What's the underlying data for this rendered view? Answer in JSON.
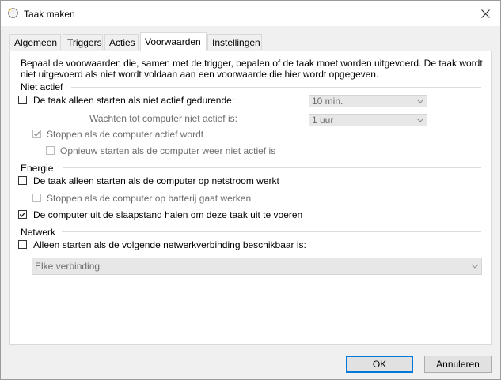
{
  "window": {
    "title": "Taak maken",
    "icon": "clock-icon",
    "close_icon": "close-icon"
  },
  "tabs": [
    {
      "label": "Algemeen",
      "active": false
    },
    {
      "label": "Triggers",
      "active": false
    },
    {
      "label": "Acties",
      "active": false
    },
    {
      "label": "Voorwaarden",
      "active": true
    },
    {
      "label": "Instellingen",
      "active": false
    }
  ],
  "description": "Bepaal de voorwaarden die, samen met de trigger, bepalen of de taak moet worden uitgevoerd. De taak wordt niet uitgevoerd als niet wordt voldaan aan een voorwaarde die hier wordt opgegeven.",
  "idle": {
    "heading": "Niet actief",
    "start_only_if_idle": {
      "label": "De taak alleen starten als niet actief gedurende:",
      "checked": false
    },
    "idle_duration": {
      "value": "10 min."
    },
    "wait_label": "Wachten tot computer niet actief is:",
    "wait_duration": {
      "value": "1 uur"
    },
    "stop_if_active": {
      "label": "Stoppen als de computer actief wordt",
      "checked": true,
      "disabled": true
    },
    "restart_if_idle": {
      "label": "Opnieuw starten als de computer weer niet actief is",
      "checked": false,
      "disabled": true
    }
  },
  "power": {
    "heading": "Energie",
    "ac_only": {
      "label": "De taak alleen starten als de computer op netstroom werkt",
      "checked": false
    },
    "stop_on_battery": {
      "label": "Stoppen als de computer op batterij gaat werken",
      "checked": false,
      "disabled": true
    },
    "wake": {
      "label": "De computer uit de slaapstand halen om deze taak uit te voeren",
      "checked": true
    }
  },
  "network": {
    "heading": "Netwerk",
    "only_if_network": {
      "label": "Alleen starten als de volgende netwerkverbinding beschikbaar is:",
      "checked": false
    },
    "connection": {
      "value": "Elke verbinding"
    }
  },
  "buttons": {
    "ok": "OK",
    "cancel": "Annuleren"
  },
  "colors": {
    "accent": "#0078d7",
    "disabled_text": "#6d6d6d",
    "window_bg": "#f0f0f0"
  }
}
